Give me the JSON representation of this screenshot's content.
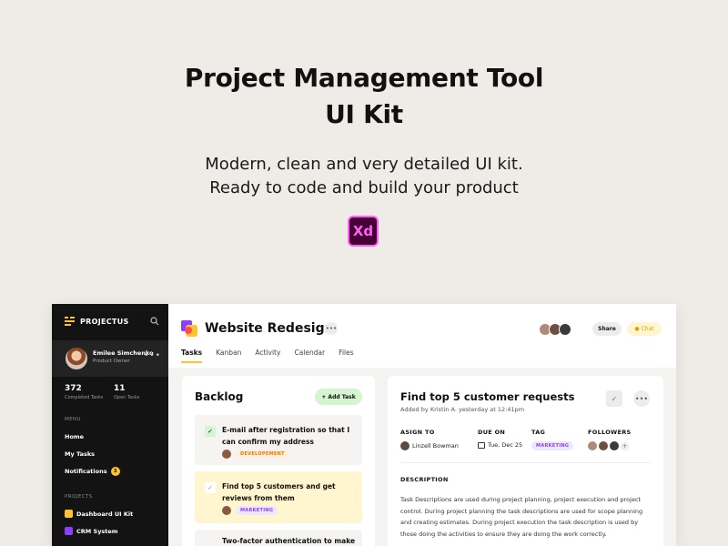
{
  "hero": {
    "title_line1": "Project Management Tool",
    "title_line2": "UI Kit",
    "subtitle_line1": "Modern, clean and very detailed UI kit.",
    "subtitle_line2": "Ready to code and build your product",
    "badge": "Xd"
  },
  "sidebar": {
    "brand": "PROJECTUS",
    "user": {
      "name": "Emilee Simchenko",
      "role": "Product Owner"
    },
    "stats": [
      {
        "value": "372",
        "label": "Completed Tasks"
      },
      {
        "value": "11",
        "label": "Open Tasks"
      }
    ],
    "menu_label": "MENU",
    "menu": [
      {
        "label": "Home"
      },
      {
        "label": "My Tasks"
      },
      {
        "label": "Notifications",
        "badge": "3"
      }
    ],
    "projects_label": "PROJECTS",
    "projects": [
      {
        "label": "Dashboard UI Kit",
        "color": "#ffc42d"
      },
      {
        "label": "CRM System",
        "color": "#8a3ffc"
      }
    ]
  },
  "header": {
    "title": "Website Redesign",
    "tabs": [
      "Tasks",
      "Kanban",
      "Activity",
      "Calendar",
      "Files"
    ],
    "active_tab": "Tasks",
    "share_label": "Share",
    "chat_label": "Chat"
  },
  "backlog": {
    "title": "Backlog",
    "add_label": "+ Add Task",
    "tasks": [
      {
        "title": "E-mail after registration so that I can confirm my address",
        "tag": "DEVELOPEMENT",
        "done": true
      },
      {
        "title": "Find top 5 customers and get reviews from them",
        "tag": "MARKETING",
        "done": false
      },
      {
        "title": "Two-factor authentication to make"
      }
    ]
  },
  "detail": {
    "title": "Find top 5 customer requests",
    "added": "Added by Kristin A. yesterday at 12:41pm",
    "assign_label": "ASIGN TO",
    "assignee": "Linzell Bowman",
    "due_label": "DUE ON",
    "due": "Tue, Dec 25",
    "tag_label": "TAG",
    "tag": "MARKETING",
    "followers_label": "FOLLOWERS",
    "description_label": "DESCRIPTION",
    "description": "Task Descriptions are used during project planning, project execution and project control. During project planning the task descriptions are used for scope planning and creating estimates. During project execution the task description is used by those doing the activities to ensure they are doing the work correctly."
  },
  "colors": {
    "accent": "#ffc42d",
    "sidebar_bg": "#131313",
    "green_soft": "#d4f5d0",
    "yellow_soft": "#fff6cf",
    "purple": "#8a3ffc",
    "orange": "#e87a00"
  }
}
